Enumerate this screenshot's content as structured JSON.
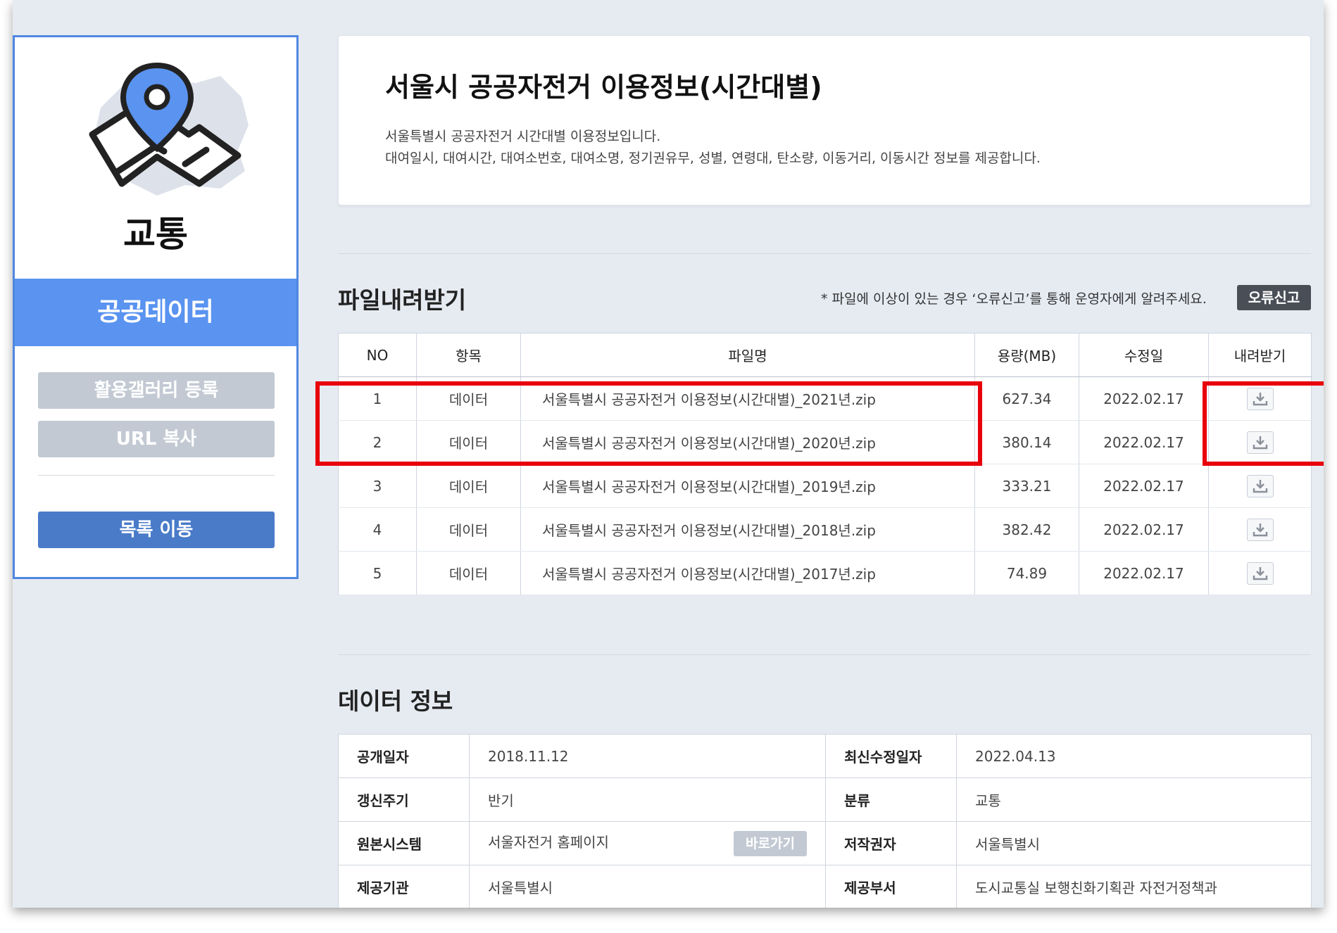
{
  "sidebar": {
    "category": "교통",
    "section": "공공데이터",
    "gallery_button": "활용갤러리 등록",
    "url_button": "URL 복사",
    "list_button": "목록 이동",
    "illustration": "map-pin-icon"
  },
  "dataset": {
    "title": "서울시 공공자전거 이용정보(시간대별)",
    "desc_line1": "서울특별시 공공자전거 시간대별 이용정보입니다.",
    "desc_line2": "대여일시, 대여시간, 대여소번호, 대여소명, 정기권유무, 성별, 연령대, 탄소량, 이동거리, 이동시간 정보를 제공합니다."
  },
  "files": {
    "section_title": "파일내려받기",
    "notice": "* 파일에 이상이 있는 경우 ‘오류신고’를 통해 운영자에게 알려주세요.",
    "report_button": "오류신고",
    "headers": {
      "no": "NO",
      "item": "항목",
      "name": "파일명",
      "size": "용량(MB)",
      "modified": "수정일",
      "download": "내려받기"
    },
    "rows": [
      {
        "no": "1",
        "item": "데이터",
        "name": "서울특별시 공공자전거 이용정보(시간대별)_2021년.zip",
        "size": "627.34",
        "modified": "2022.02.17",
        "icon": "download-icon"
      },
      {
        "no": "2",
        "item": "데이터",
        "name": "서울특별시 공공자전거 이용정보(시간대별)_2020년.zip",
        "size": "380.14",
        "modified": "2022.02.17",
        "icon": "download-icon"
      },
      {
        "no": "3",
        "item": "데이터",
        "name": "서울특별시 공공자전거 이용정보(시간대별)_2019년.zip",
        "size": "333.21",
        "modified": "2022.02.17",
        "icon": "download-icon"
      },
      {
        "no": "4",
        "item": "데이터",
        "name": "서울특별시 공공자전거 이용정보(시간대별)_2018년.zip",
        "size": "382.42",
        "modified": "2022.02.17",
        "icon": "download-icon"
      },
      {
        "no": "5",
        "item": "데이터",
        "name": "서울특별시 공공자전거 이용정보(시간대별)_2017년.zip",
        "size": "74.89",
        "modified": "2022.02.17",
        "icon": "download-icon"
      }
    ]
  },
  "info": {
    "section_title": "데이터 정보",
    "rows": [
      {
        "l1": "공개일자",
        "v1": "2018.11.12",
        "l2": "최신수정일자",
        "v2": "2022.04.13"
      },
      {
        "l1": "갱신주기",
        "v1": "반기",
        "l2": "분류",
        "v2": "교통"
      },
      {
        "l1": "원본시스템",
        "v1": "서울자전거 홈페이지",
        "l2": "저작권자",
        "v2": "서울특별시"
      },
      {
        "l1": "제공기관",
        "v1": "서울특별시",
        "l2": "제공부서",
        "v2": "도시교통실 보행친화기획관 자전거정책과"
      }
    ],
    "goto_button": "바로가기"
  },
  "annotation_color": "#e8000b"
}
